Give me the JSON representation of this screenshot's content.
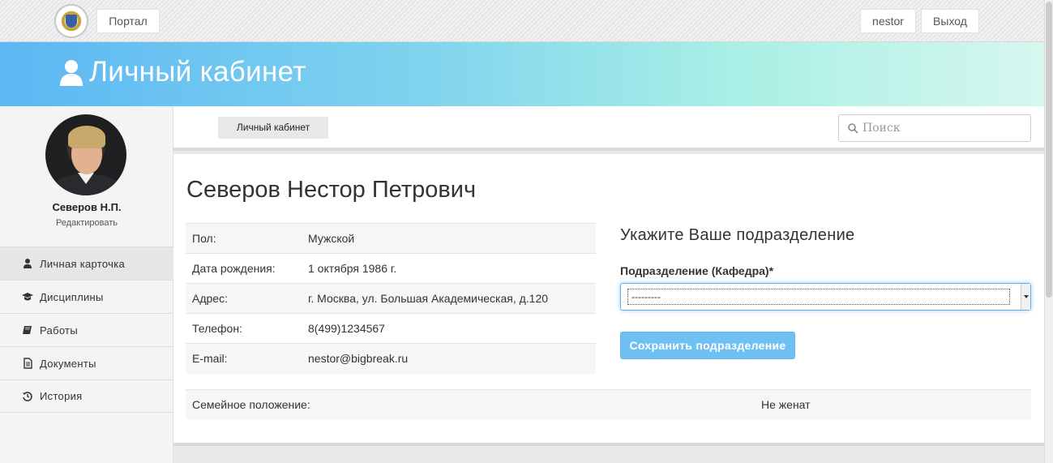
{
  "topbar": {
    "portal_label": "Портал",
    "user_label": "nestor",
    "logout_label": "Выход"
  },
  "banner": {
    "title": "Личный кабинет",
    "icon": "user-icon"
  },
  "sidebar": {
    "short_name": "Северов Н.П.",
    "edit_label": "Редактировать",
    "items": [
      {
        "label": "Личная карточка",
        "icon": "user-icon",
        "active": true
      },
      {
        "label": "Дисциплины",
        "icon": "graduation-cap-icon",
        "active": false
      },
      {
        "label": "Работы",
        "icon": "book-icon",
        "active": false
      },
      {
        "label": "Документы",
        "icon": "document-icon",
        "active": false
      },
      {
        "label": "История",
        "icon": "history-icon",
        "active": false
      }
    ]
  },
  "header": {
    "breadcrumb": "Личный кабинет",
    "search_placeholder": "Поиск"
  },
  "profile": {
    "full_name": "Северов Нестор Петрович",
    "fields": [
      {
        "label": "Пол:",
        "value": "Мужской"
      },
      {
        "label": "Дата рождения:",
        "value": "1 октября 1986 г."
      },
      {
        "label": "Адрес:",
        "value": "г. Москва, ул. Большая Академическая, д.120"
      },
      {
        "label": "Телефон:",
        "value": "8(499)1234567"
      },
      {
        "label": "E-mail:",
        "value": "nestor@bigbreak.ru"
      }
    ],
    "family": {
      "label": "Семейное положение:",
      "value": "Не женат"
    }
  },
  "department": {
    "title": "Укажите Ваше подразделение",
    "field_label": "Подразделение (Кафедра)*",
    "selected": "---------",
    "save_label": "Сохранить подразделение"
  },
  "colors": {
    "accent": "#6fc0f3",
    "banner_start": "#5cb7f3",
    "banner_end": "#d6f7ee"
  }
}
